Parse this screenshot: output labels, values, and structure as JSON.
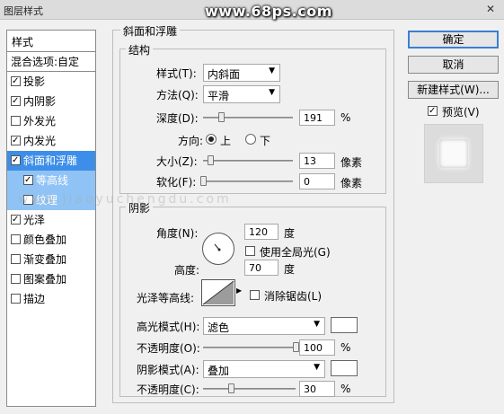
{
  "window": {
    "title": "图层样式",
    "watermark": "www.68ps.com",
    "watermark2": "www.jiaoyuchengdu.com",
    "close": "✕"
  },
  "left": {
    "header": "样式",
    "blend": "混合选项:自定",
    "items": [
      {
        "label": "投影",
        "checked": true
      },
      {
        "label": "内阴影",
        "checked": true
      },
      {
        "label": "外发光",
        "checked": false
      },
      {
        "label": "内发光",
        "checked": true
      },
      {
        "label": "斜面和浮雕",
        "checked": true
      },
      {
        "label": "等高线",
        "checked": true
      },
      {
        "label": "纹理",
        "checked": false
      },
      {
        "label": "光泽",
        "checked": true
      },
      {
        "label": "颜色叠加",
        "checked": false
      },
      {
        "label": "渐变叠加",
        "checked": false
      },
      {
        "label": "图案叠加",
        "checked": false
      },
      {
        "label": "描边",
        "checked": false
      }
    ]
  },
  "bevel": {
    "section": "斜面和浮雕",
    "structure": "结构",
    "style_label": "样式(T):",
    "style_value": "内斜面",
    "method_label": "方法(Q):",
    "method_value": "平滑",
    "depth_label": "深度(D):",
    "depth_value": "191",
    "depth_unit": "%",
    "depth_pct": 0.2,
    "direction_label": "方向:",
    "dir_up": "上",
    "dir_down": "下",
    "size_label": "大小(Z):",
    "size_value": "13",
    "size_unit": "像素",
    "size_pct": 0.08,
    "soften_label": "软化(F):",
    "soften_value": "0",
    "soften_unit": "像素",
    "soften_pct": 0.0
  },
  "shading": {
    "title": "阴影",
    "angle_label": "角度(N):",
    "angle_value": "120",
    "angle_unit": "度",
    "global_light": "使用全局光(G)",
    "altitude_label": "高度:",
    "altitude_value": "70",
    "altitude_unit": "度",
    "gloss_label": "光泽等高线:",
    "antialias": "消除锯齿(L)",
    "highlight_label": "高光模式(H):",
    "highlight_value": "滤色",
    "hl_opacity_label": "不透明度(O):",
    "hl_opacity_value": "100",
    "hl_opacity_pct": 1.0,
    "shadow_label": "阴影模式(A):",
    "shadow_value": "叠加",
    "sh_opacity_label": "不透明度(C):",
    "sh_opacity_value": "30",
    "sh_opacity_pct": 0.3,
    "percent": "%"
  },
  "right": {
    "ok": "确定",
    "cancel": "取消",
    "new_style": "新建样式(W)...",
    "preview": "预览(V)"
  }
}
